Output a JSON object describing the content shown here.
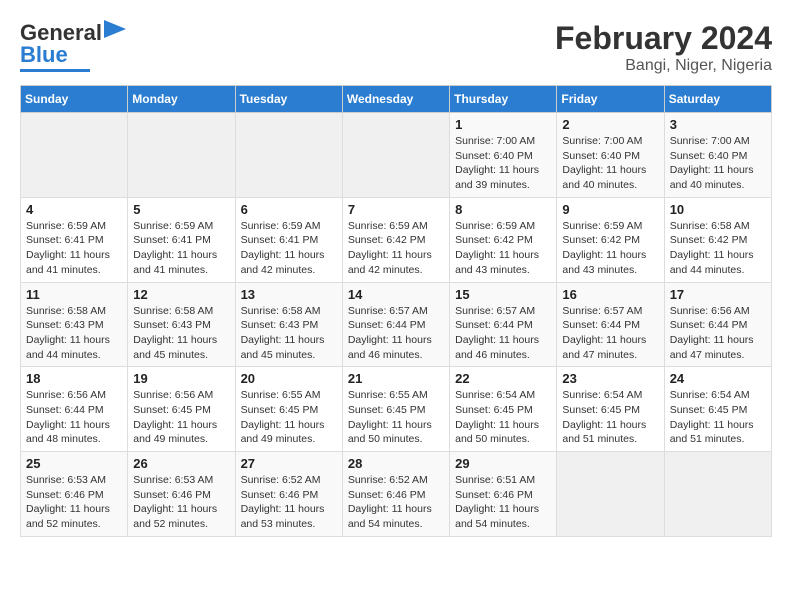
{
  "header": {
    "logo_general": "General",
    "logo_blue": "Blue",
    "title": "February 2024",
    "subtitle": "Bangi, Niger, Nigeria"
  },
  "weekdays": [
    "Sunday",
    "Monday",
    "Tuesday",
    "Wednesday",
    "Thursday",
    "Friday",
    "Saturday"
  ],
  "weeks": [
    [
      {
        "day": "",
        "sunrise": "",
        "sunset": "",
        "daylight": ""
      },
      {
        "day": "",
        "sunrise": "",
        "sunset": "",
        "daylight": ""
      },
      {
        "day": "",
        "sunrise": "",
        "sunset": "",
        "daylight": ""
      },
      {
        "day": "",
        "sunrise": "",
        "sunset": "",
        "daylight": ""
      },
      {
        "day": "1",
        "sunrise": "Sunrise: 7:00 AM",
        "sunset": "Sunset: 6:40 PM",
        "daylight": "Daylight: 11 hours and 39 minutes."
      },
      {
        "day": "2",
        "sunrise": "Sunrise: 7:00 AM",
        "sunset": "Sunset: 6:40 PM",
        "daylight": "Daylight: 11 hours and 40 minutes."
      },
      {
        "day": "3",
        "sunrise": "Sunrise: 7:00 AM",
        "sunset": "Sunset: 6:40 PM",
        "daylight": "Daylight: 11 hours and 40 minutes."
      }
    ],
    [
      {
        "day": "4",
        "sunrise": "Sunrise: 6:59 AM",
        "sunset": "Sunset: 6:41 PM",
        "daylight": "Daylight: 11 hours and 41 minutes."
      },
      {
        "day": "5",
        "sunrise": "Sunrise: 6:59 AM",
        "sunset": "Sunset: 6:41 PM",
        "daylight": "Daylight: 11 hours and 41 minutes."
      },
      {
        "day": "6",
        "sunrise": "Sunrise: 6:59 AM",
        "sunset": "Sunset: 6:41 PM",
        "daylight": "Daylight: 11 hours and 42 minutes."
      },
      {
        "day": "7",
        "sunrise": "Sunrise: 6:59 AM",
        "sunset": "Sunset: 6:42 PM",
        "daylight": "Daylight: 11 hours and 42 minutes."
      },
      {
        "day": "8",
        "sunrise": "Sunrise: 6:59 AM",
        "sunset": "Sunset: 6:42 PM",
        "daylight": "Daylight: 11 hours and 43 minutes."
      },
      {
        "day": "9",
        "sunrise": "Sunrise: 6:59 AM",
        "sunset": "Sunset: 6:42 PM",
        "daylight": "Daylight: 11 hours and 43 minutes."
      },
      {
        "day": "10",
        "sunrise": "Sunrise: 6:58 AM",
        "sunset": "Sunset: 6:42 PM",
        "daylight": "Daylight: 11 hours and 44 minutes."
      }
    ],
    [
      {
        "day": "11",
        "sunrise": "Sunrise: 6:58 AM",
        "sunset": "Sunset: 6:43 PM",
        "daylight": "Daylight: 11 hours and 44 minutes."
      },
      {
        "day": "12",
        "sunrise": "Sunrise: 6:58 AM",
        "sunset": "Sunset: 6:43 PM",
        "daylight": "Daylight: 11 hours and 45 minutes."
      },
      {
        "day": "13",
        "sunrise": "Sunrise: 6:58 AM",
        "sunset": "Sunset: 6:43 PM",
        "daylight": "Daylight: 11 hours and 45 minutes."
      },
      {
        "day": "14",
        "sunrise": "Sunrise: 6:57 AM",
        "sunset": "Sunset: 6:44 PM",
        "daylight": "Daylight: 11 hours and 46 minutes."
      },
      {
        "day": "15",
        "sunrise": "Sunrise: 6:57 AM",
        "sunset": "Sunset: 6:44 PM",
        "daylight": "Daylight: 11 hours and 46 minutes."
      },
      {
        "day": "16",
        "sunrise": "Sunrise: 6:57 AM",
        "sunset": "Sunset: 6:44 PM",
        "daylight": "Daylight: 11 hours and 47 minutes."
      },
      {
        "day": "17",
        "sunrise": "Sunrise: 6:56 AM",
        "sunset": "Sunset: 6:44 PM",
        "daylight": "Daylight: 11 hours and 47 minutes."
      }
    ],
    [
      {
        "day": "18",
        "sunrise": "Sunrise: 6:56 AM",
        "sunset": "Sunset: 6:44 PM",
        "daylight": "Daylight: 11 hours and 48 minutes."
      },
      {
        "day": "19",
        "sunrise": "Sunrise: 6:56 AM",
        "sunset": "Sunset: 6:45 PM",
        "daylight": "Daylight: 11 hours and 49 minutes."
      },
      {
        "day": "20",
        "sunrise": "Sunrise: 6:55 AM",
        "sunset": "Sunset: 6:45 PM",
        "daylight": "Daylight: 11 hours and 49 minutes."
      },
      {
        "day": "21",
        "sunrise": "Sunrise: 6:55 AM",
        "sunset": "Sunset: 6:45 PM",
        "daylight": "Daylight: 11 hours and 50 minutes."
      },
      {
        "day": "22",
        "sunrise": "Sunrise: 6:54 AM",
        "sunset": "Sunset: 6:45 PM",
        "daylight": "Daylight: 11 hours and 50 minutes."
      },
      {
        "day": "23",
        "sunrise": "Sunrise: 6:54 AM",
        "sunset": "Sunset: 6:45 PM",
        "daylight": "Daylight: 11 hours and 51 minutes."
      },
      {
        "day": "24",
        "sunrise": "Sunrise: 6:54 AM",
        "sunset": "Sunset: 6:45 PM",
        "daylight": "Daylight: 11 hours and 51 minutes."
      }
    ],
    [
      {
        "day": "25",
        "sunrise": "Sunrise: 6:53 AM",
        "sunset": "Sunset: 6:46 PM",
        "daylight": "Daylight: 11 hours and 52 minutes."
      },
      {
        "day": "26",
        "sunrise": "Sunrise: 6:53 AM",
        "sunset": "Sunset: 6:46 PM",
        "daylight": "Daylight: 11 hours and 52 minutes."
      },
      {
        "day": "27",
        "sunrise": "Sunrise: 6:52 AM",
        "sunset": "Sunset: 6:46 PM",
        "daylight": "Daylight: 11 hours and 53 minutes."
      },
      {
        "day": "28",
        "sunrise": "Sunrise: 6:52 AM",
        "sunset": "Sunset: 6:46 PM",
        "daylight": "Daylight: 11 hours and 54 minutes."
      },
      {
        "day": "29",
        "sunrise": "Sunrise: 6:51 AM",
        "sunset": "Sunset: 6:46 PM",
        "daylight": "Daylight: 11 hours and 54 minutes."
      },
      {
        "day": "",
        "sunrise": "",
        "sunset": "",
        "daylight": ""
      },
      {
        "day": "",
        "sunrise": "",
        "sunset": "",
        "daylight": ""
      }
    ]
  ]
}
